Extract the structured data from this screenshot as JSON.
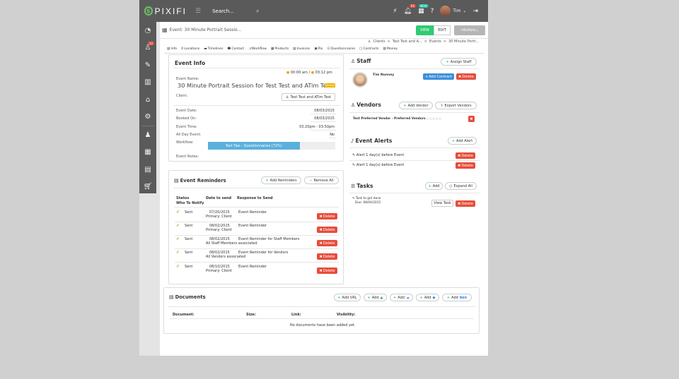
{
  "app": {
    "logo_text": "PIXIFI",
    "search_label": "Search...",
    "notifications_count": "65",
    "messages_count": "NEW",
    "user_name": "Tim",
    "sidebar_badge": "12"
  },
  "header": {
    "event_title_value": "Event: 30 Minute Portrait Sessio...",
    "view_label": "VIEW",
    "edit_label": "EDIT",
    "actions_label": "Actions",
    "breadcrumbs": [
      "Clients",
      "Test Test and A...",
      "Events",
      "30 Minute Portr..."
    ]
  },
  "tabs": [
    "Info",
    "Locations",
    "Timelines",
    "Contact",
    "Workflow",
    "Products",
    "Invoices",
    "Pix",
    "Questionnaires",
    "Contracts",
    "Money"
  ],
  "event_info": {
    "title": "Event Info",
    "time_start": "00:00 am",
    "time_sep": "/",
    "time_end": "03:12 pm",
    "event_name_label": "Event Name:",
    "event_name": "30 Minute Portrait Session for Test Test and ATim Test",
    "event_badge": "Portrait",
    "client_label": "Client:",
    "client_value": "Test Test and ATim Test",
    "event_date_label": "Event Date:",
    "event_date": "08/03/2015",
    "booked_on_label": "Booked On:",
    "booked_on": "08/03/2015",
    "event_time_label": "Event Time:",
    "event_time": "03:20pm - 03:50pm",
    "all_day_label": "All Day Event:",
    "all_day": "No",
    "workflow_label": "Workflow:",
    "workflow_progress_text": "Test Two - Questionnaires (72%)",
    "workflow_progress": 72,
    "event_notes_label": "Event Notes:"
  },
  "reminders": {
    "title": "Event Reminders",
    "add_label": "Add Reminders",
    "remove_label": "Remove All",
    "col_status": "Status",
    "col_who": "Who To Notify",
    "col_date": "Date to send",
    "col_response": "Response to Send",
    "delete_label": "Delete",
    "rows": [
      {
        "status": "Sent",
        "date": "07/20/2015",
        "who": "Primary: Client",
        "response": "Event Reminder"
      },
      {
        "status": "Sent",
        "date": "08/02/2015",
        "who": "Primary: Client",
        "response": "Event Reminder"
      },
      {
        "status": "Sent",
        "date": "08/02/2015",
        "who": "All Staff Members associated",
        "response": "Event Reminder for Staff Members"
      },
      {
        "status": "Sent",
        "date": "08/02/2015",
        "who": "All Vendors associated",
        "response": "Event Reminder for Vendors"
      },
      {
        "status": "Sent",
        "date": "08/10/2015",
        "who": "Primary: Client",
        "response": "Event Reminder"
      }
    ]
  },
  "staff": {
    "title": "Staff",
    "assign_label": "Assign Staff",
    "member_name": "Tim Nunney",
    "add_contract_label": "Add Contract",
    "delete_label": "Delete"
  },
  "vendors": {
    "title": "Vendors",
    "add_label": "Add Vendor",
    "export_label": "Export Vendors",
    "vendor_text": "Test Preferred Vendor - Preferred Vendors",
    "rating": "☆☆☆☆☆"
  },
  "alerts": {
    "title": "Event Alerts",
    "add_label": "Add Alert",
    "delete_label": "Delete",
    "items": [
      "Alert 1 day(s) before Event",
      "Alert 1 day(s) before Event"
    ]
  },
  "tasks": {
    "title": "Tasks",
    "add_label": "Add",
    "expand_label": "Expand All",
    "task_name": "Task to get done",
    "task_due": "Due: 08/04/2015",
    "view_label": "View Task",
    "delete_label": "Delete"
  },
  "documents": {
    "title": "Documents",
    "add_url": "Add URL",
    "add_label": "Add",
    "col_document": "Document:",
    "col_size": "Size:",
    "col_link": "Link:",
    "col_visibility": "Visibility:",
    "empty_text": "No documents have been added yet."
  },
  "colors": {
    "topbar": "#5a5a5a",
    "view_green": "#2ecc71",
    "delete_red": "#e74c3c",
    "contract_blue": "#3b8fd9",
    "progress": "#5ab0dc"
  }
}
